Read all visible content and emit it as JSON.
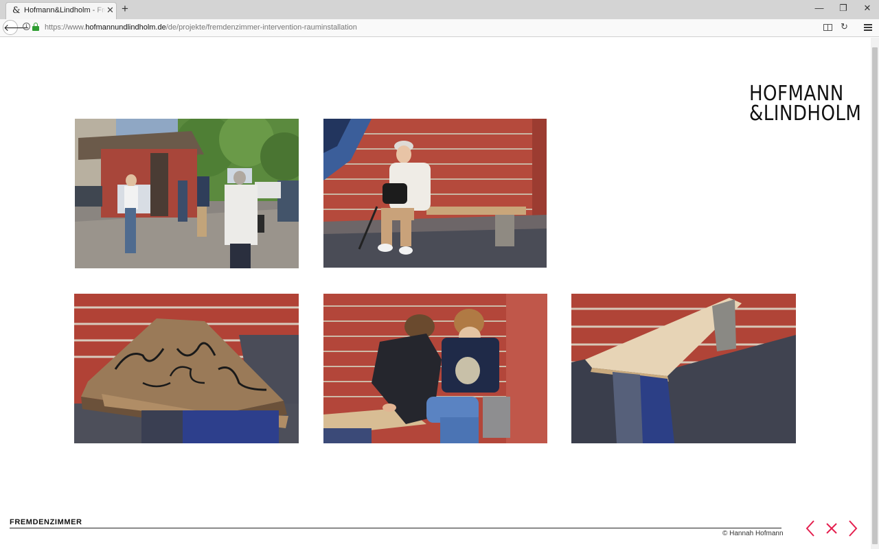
{
  "browser": {
    "tab_title": "Hofmann&Lindholm - Fremdenzimmer",
    "tab_favicon": "&",
    "url_prefix": "https://www.",
    "url_domain": "hofmannundlindholm.de",
    "url_path": "/de/projekte/fremdenzimmer-intervention-rauminstallation"
  },
  "logo": {
    "line1": "HOFMANN",
    "line2": "&LINDHOLM"
  },
  "gallery": [
    {
      "name": "street-scene-kiosk-photo"
    },
    {
      "name": "elderly-woman-on-bench-photo"
    },
    {
      "name": "graffiti-bench-photo"
    },
    {
      "name": "boys-on-bench-photo"
    },
    {
      "name": "new-bench-photo"
    }
  ],
  "footer": {
    "project_title": "FREMDENZIMMER",
    "credit": "© Hannah Hofmann"
  },
  "colors": {
    "accent": "#e4204f",
    "text": "#111111"
  },
  "icons": [
    "back-arrow-icon",
    "info-icon",
    "lock-icon",
    "reader-view-icon",
    "reload-icon",
    "hamburger-menu-icon",
    "previous-arrow-icon",
    "close-x-icon",
    "next-arrow-icon"
  ]
}
